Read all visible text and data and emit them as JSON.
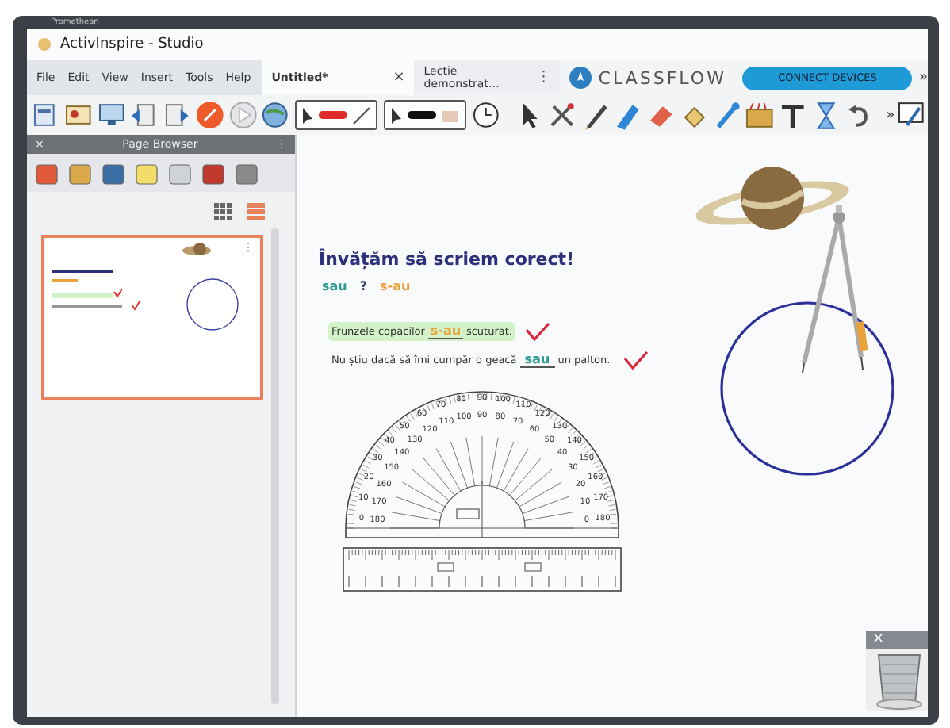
{
  "bezel": {
    "brand": "Promethean"
  },
  "window": {
    "title": "ActivInspire - Studio"
  },
  "menu": [
    "File",
    "Edit",
    "View",
    "Insert",
    "Tools",
    "Help"
  ],
  "tabs": [
    {
      "label": "Untitled*",
      "selected": true,
      "action": "×"
    },
    {
      "label": "Lectie demonstrat…",
      "selected": false,
      "action": "⋮"
    }
  ],
  "classflow": {
    "logo": "CLASSFLOW",
    "button": "CONNECT DEVICES",
    "more": "»"
  },
  "toolbar": {
    "more": "»"
  },
  "page_browser": {
    "title": "Page Browser",
    "close": "×",
    "menu": "⋮",
    "views": [
      {
        "kind": "grid",
        "selected": false
      },
      {
        "kind": "list",
        "selected": true
      }
    ],
    "pages": [
      {
        "selected": true,
        "menu": "⋮"
      }
    ]
  },
  "page": {
    "title": "Învățăm să scriem corect!",
    "options": [
      {
        "text": "sau",
        "color": "#2a9d8f"
      },
      {
        "text": "?",
        "color": "#333366"
      },
      {
        "text": "s-au",
        "color": "#e9a23b"
      }
    ],
    "sentences": [
      {
        "before": "Frunzele copacilor",
        "answer": {
          "text": "s-au",
          "color": "#e9a23b"
        },
        "after": "scuturat.",
        "highlighted": true,
        "correct": true
      },
      {
        "before": "Nu știu dacă să îmi cumpăr o geacă",
        "answer": {
          "text": "sau",
          "color": "#2a9d8f"
        },
        "after": "un palton.",
        "highlighted": false,
        "correct": true
      }
    ],
    "protractor": {
      "outer_labels": [
        "0",
        "10",
        "20",
        "30",
        "40",
        "50",
        "60",
        "70",
        "80",
        "90",
        "100",
        "110",
        "120",
        "130",
        "140",
        "150",
        "160",
        "170",
        "180"
      ],
      "inner_labels": [
        "180",
        "170",
        "160",
        "150",
        "140",
        "130",
        "120",
        "110",
        "100",
        "90",
        "80",
        "70",
        "60",
        "50",
        "40",
        "30",
        "20",
        "10",
        "0"
      ]
    }
  },
  "trash": {
    "close": "×"
  }
}
